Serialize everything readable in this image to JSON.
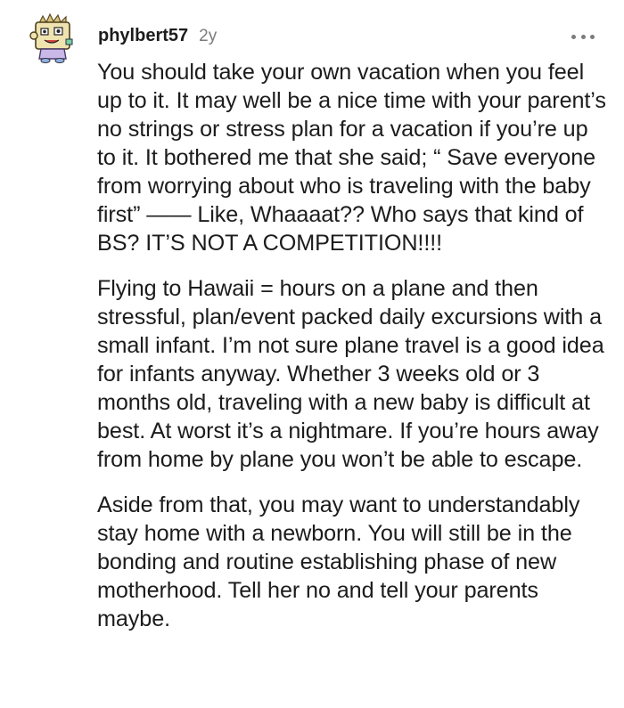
{
  "comment": {
    "username": "phylbert57",
    "age": "2y",
    "avatar_icon": "reddit-snoo-avatar-icon",
    "more_icon": "more-options-icon",
    "paragraphs": [
      "You should take your own vacation when you feel up to it. It may well be a nice time with your parent’s no strings or stress plan for a vacation if you’re up to it. It bothered me that she said; “ Save everyone from worrying about who is traveling with the baby first” —— Like, Whaaaat?? Who says that kind of BS? IT’S NOT A COMPETITION!!!!",
      "Flying to Hawaii = hours on a plane and then stressful, plan/event packed daily excursions with a small infant. I’m not sure plane travel is a good idea for infants anyway. Whether 3 weeks old or 3 months old, traveling with a new baby is difficult at best. At worst it’s a nightmare. If you’re hours away from home by plane you won’t be able to escape.",
      "Aside from that, you may want to understandably stay home with a newborn. You will still be in the bonding and routine establishing phase of new motherhood. Tell her no and tell your parents maybe."
    ]
  }
}
